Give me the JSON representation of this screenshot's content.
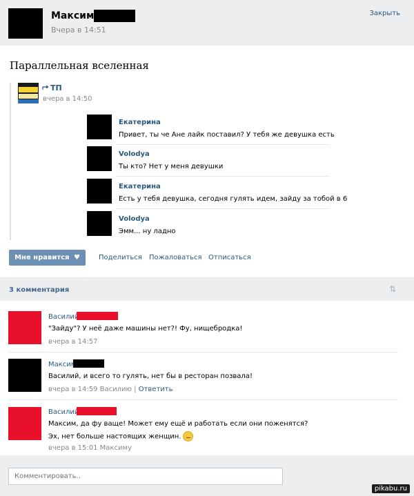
{
  "header": {
    "name": "Максим",
    "time": "Вчера в 14:51",
    "close_label": "Закрыть"
  },
  "post": {
    "title": "Параллельная вселенная",
    "repost_icon": "repost-icon",
    "group_name": "ТП",
    "group_time": "вчера в 14:50"
  },
  "chat": [
    {
      "name": "Екатерина",
      "text": "Привет, ты че Ане лайк поставил? У тебя же девушка есть"
    },
    {
      "name": "Volodya",
      "text": "Ты кто? Нет у меня девушки"
    },
    {
      "name": "Екатерина",
      "text": "Есть у тебя девушка, сегодня гулять идем, зайду за тобой в 6"
    },
    {
      "name": "Volodya",
      "text": "Эмм... ну ладно"
    }
  ],
  "actions": {
    "like_label": "Мне нравится",
    "like_icon": "heart-icon",
    "share_label": "Поделиться",
    "report_label": "Пожаловаться",
    "unsubscribe_label": "Отписаться"
  },
  "comments_header": {
    "count_label": "3 комментария",
    "sort_icon": "sort-arrows-icon"
  },
  "comments": [
    {
      "author": "Василий",
      "text_lines": [
        "\"Зайду\"? У неё даже машины нет?! Фу, нищебродка!"
      ],
      "meta": "вчера в 14:57",
      "reply": ""
    },
    {
      "author": "Максим",
      "text_lines": [
        "Василий, и всего то гулять, нет бы в ресторан позвала!"
      ],
      "meta": "вчера в 14:59 Василию |",
      "reply": "Ответить"
    },
    {
      "author": "Василий",
      "text_lines": [
        "Максим, да фу ваще! Может ему ещё и работать если они поженятся?",
        "Эх, нет больше настоящих женщин."
      ],
      "meta": "вчера в 15:01 Максиму",
      "reply": ""
    }
  ],
  "compose": {
    "placeholder": "Комментировать.."
  },
  "watermark": "pikabu.ru",
  "colors": {
    "link": "#2b587a",
    "like_button": "#6d8fb3",
    "bar_background": "#edeef0",
    "redact_red": "#e8102a",
    "redact_black": "#000000"
  }
}
